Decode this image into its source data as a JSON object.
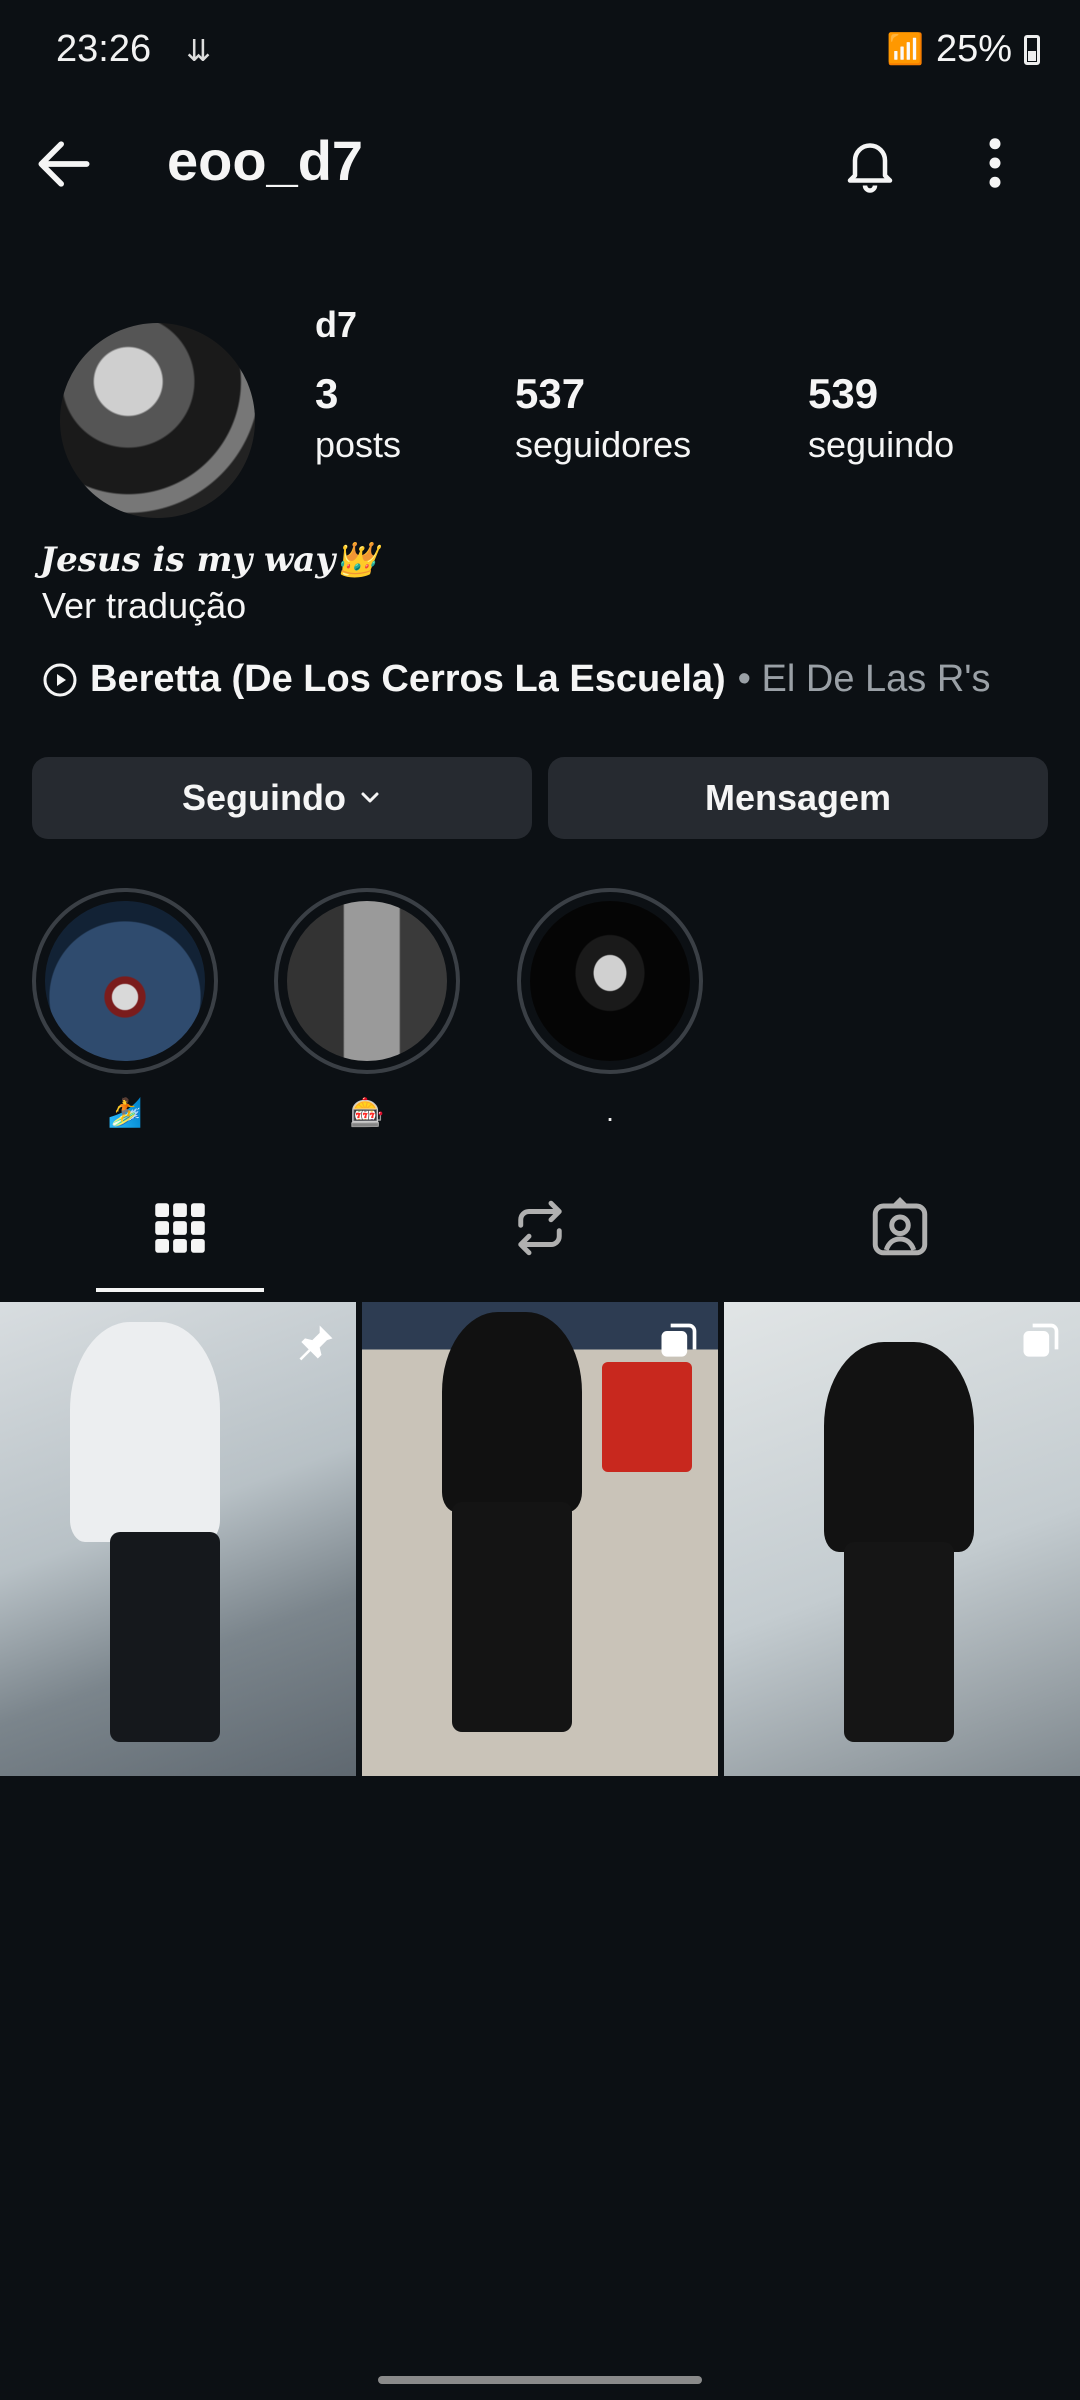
{
  "status_bar": {
    "time": "23:26",
    "battery": "25%"
  },
  "header": {
    "username": "eoo_d7"
  },
  "profile": {
    "display_name": "d7",
    "stats": [
      {
        "value": "3",
        "label": "posts"
      },
      {
        "value": "537",
        "label": "seguidores"
      },
      {
        "value": "539",
        "label": "seguindo"
      }
    ],
    "bio": "Jesus is my way👑",
    "translate_label": "Ver tradução",
    "music": {
      "song": "Beretta (De Los Cerros La Escuela)",
      "artist": "• El De Las R's"
    }
  },
  "actions": {
    "following_label": "Seguindo",
    "message_label": "Mensagem"
  },
  "highlights": [
    {
      "caption": "🏄"
    },
    {
      "caption": "🎰"
    },
    {
      "caption": "."
    }
  ],
  "tabs": {
    "active": "grid",
    "items": [
      "grid-icon",
      "reels-icon",
      "tagged-icon"
    ]
  },
  "posts": [
    {
      "badge": "pin-icon"
    },
    {
      "badge": "carousel-icon"
    },
    {
      "badge": "carousel-icon"
    }
  ]
}
